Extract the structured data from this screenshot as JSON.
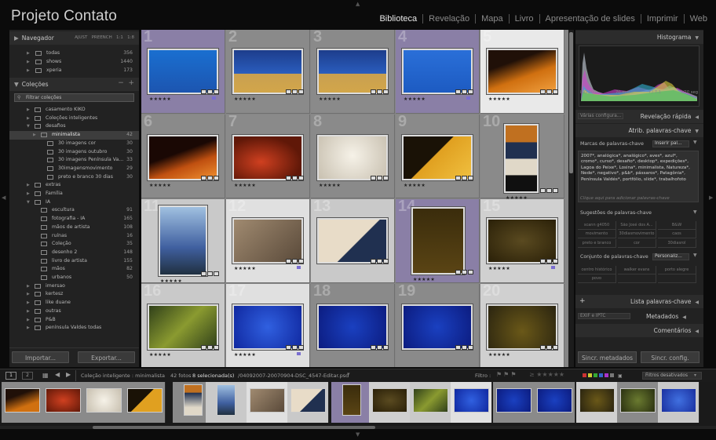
{
  "app": {
    "title": "Projeto Contato"
  },
  "modules": [
    "Biblioteca",
    "Revelação",
    "Mapa",
    "Livro",
    "Apresentação de slides",
    "Imprimir",
    "Web"
  ],
  "active_module": "Biblioteca",
  "left_panel": {
    "navigator": {
      "label": "Navegador",
      "modes": [
        "AJUST",
        "PREENCH",
        "1:1",
        "1:8"
      ]
    },
    "folders": [
      {
        "name": "todas",
        "count": "356"
      },
      {
        "name": "shows",
        "count": "1440"
      },
      {
        "name": "xperia",
        "count": "173"
      }
    ],
    "collections_label": "Coleções",
    "filter_placeholder": "Filtrar coleções",
    "collections": [
      {
        "name": "casamento KIKO",
        "count": ""
      },
      {
        "name": "Coleções inteligentes",
        "count": ""
      },
      {
        "name": "desafios",
        "count": ""
      },
      {
        "name": "minimalista",
        "count": "42"
      },
      {
        "name": "30 imagens cor",
        "count": "30"
      },
      {
        "name": "30 imagens outubro",
        "count": "30"
      },
      {
        "name": "30 imagens Península Va...",
        "count": "33"
      },
      {
        "name": "30imagensmovimento",
        "count": "29"
      },
      {
        "name": "preto e branco 30 dias",
        "count": "30"
      },
      {
        "name": "extras",
        "count": ""
      },
      {
        "name": "Família",
        "count": ""
      },
      {
        "name": "IA",
        "count": ""
      },
      {
        "name": "escultura",
        "count": "91"
      },
      {
        "name": "fotografia - IA",
        "count": "165"
      },
      {
        "name": "mãos de artista",
        "count": "108"
      },
      {
        "name": "ruínas",
        "count": "16"
      },
      {
        "name": "Coleção",
        "count": "35"
      },
      {
        "name": "desenho 2",
        "count": "148"
      },
      {
        "name": "livro de artista",
        "count": "155"
      },
      {
        "name": "mãos",
        "count": "82"
      },
      {
        "name": "urbanos",
        "count": "50"
      },
      {
        "name": "imersao",
        "count": ""
      },
      {
        "name": "kertesz",
        "count": ""
      },
      {
        "name": "like duane",
        "count": ""
      },
      {
        "name": "outras",
        "count": ""
      },
      {
        "name": "P&B",
        "count": ""
      },
      {
        "name": "península Valdes todas",
        "count": ""
      }
    ],
    "import_label": "Importar...",
    "export_label": "Exportar..."
  },
  "grid": {
    "cells": [
      {
        "n": "1",
        "stars": "★★★★★"
      },
      {
        "n": "2",
        "stars": "★★★★★"
      },
      {
        "n": "3",
        "stars": "★★★★★"
      },
      {
        "n": "4",
        "stars": "★★★★★"
      },
      {
        "n": "5",
        "stars": "★★★★★"
      },
      {
        "n": "6",
        "stars": "★★★★★"
      },
      {
        "n": "7",
        "stars": "★★★★★"
      },
      {
        "n": "8",
        "stars": "★★★★★"
      },
      {
        "n": "9",
        "stars": "★★★★★"
      },
      {
        "n": "10",
        "stars": "★★★★★"
      },
      {
        "n": "11",
        "stars": "★★★★★"
      },
      {
        "n": "12",
        "stars": "★★★★★"
      },
      {
        "n": "13",
        "stars": ""
      },
      {
        "n": "14",
        "stars": "★★★★★"
      },
      {
        "n": "15",
        "stars": "★★★★★"
      },
      {
        "n": "16",
        "stars": "★★★★★"
      },
      {
        "n": "17",
        "stars": "★★★★★"
      },
      {
        "n": "18",
        "stars": ""
      },
      {
        "n": "19",
        "stars": ""
      },
      {
        "n": "20",
        "stars": "★★★★★"
      }
    ]
  },
  "right_panel": {
    "histogram": {
      "label": "Histograma",
      "iso": "ISO 200",
      "focal": "70 mm",
      "aperture": "f / 7,1",
      "shutter": "1/20 seg"
    },
    "quick_develop": {
      "label": "Revelação rápida",
      "preset": "Várias configura..."
    },
    "keywording": {
      "label": "Atrib. palavras-chave",
      "tags_label": "Marcas de palavras-chave",
      "mode": "Inserir pal...",
      "keywords": "2007*, analógica*, analógico*, aves*, azul*, cromo*, curso*, desafio*, desktop*, expedições*, Lagoa do Peixe*, Losina*, minimalista, Natureza*, Nede*, negativo*, p&b*, pássaros*, Patagônia*, Península Valdés*, portfólio, slide*, trabalhofoto",
      "hint": "Clique aqui para adicionar palavras-chave",
      "suggestions_label": "Sugestões de palavras-chave",
      "suggestions": [
        "scann g4050",
        "São José dos A...",
        "B&W",
        "movimento",
        "30diasmovimento",
        "caos",
        "preto e branco",
        "cor",
        "30diasrol"
      ],
      "set_label": "Conjunto de palavras-chave",
      "set_value": "Personaliz...",
      "set_items": [
        "centro histórico",
        "walker evans",
        "porto alegre",
        "povo",
        "",
        ""
      ]
    },
    "keyword_list_label": "Lista palavras-chave",
    "metadata_label": "Metadados",
    "metadata_preset": "EXIF e IPTC",
    "comments_label": "Comentários",
    "sync_meta_label": "Sincr. metadados",
    "sync_settings_label": "Sincr. config."
  },
  "filmstrip_bar": {
    "pages": [
      "1",
      "2"
    ],
    "source": "Coleção inteligente : minimalista",
    "count": "42 fotos",
    "selected": "8 selecionada(s)",
    "path": "/04092007-20070904-DSC_4547-Editar.psd",
    "filter_label": "Filtro :",
    "filters_off": "Filtros desativados"
  }
}
